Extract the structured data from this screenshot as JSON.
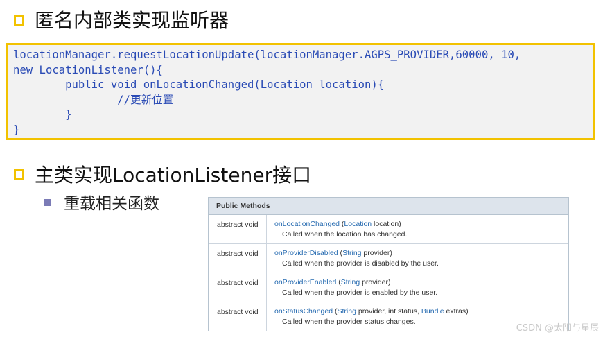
{
  "heading1": "匿名内部类实现监听器",
  "code_lines": [
    "locationManager.requestLocationUpdate(locationManager.AGPS_PROVIDER,60000, 10,",
    "new LocationListener(){",
    "        public void onLocationChanged(Location location){",
    "                //更新位置",
    "        }",
    "}"
  ],
  "heading2": "主类实现LocationListener接口",
  "sub_bullet": "重载相关函数",
  "methods_table": {
    "header": "Public Methods",
    "rows": [
      {
        "modifier": "abstract void",
        "name": "onLocationChanged",
        "p1": " (",
        "link": "Location",
        "p2": " location)",
        "desc": "Called when the location has changed."
      },
      {
        "modifier": "abstract void",
        "name": "onProviderDisabled",
        "p1": " (",
        "link": "String",
        "p2": " provider)",
        "desc": "Called when the provider is disabled by the user."
      },
      {
        "modifier": "abstract void",
        "name": "onProviderEnabled",
        "p1": " (",
        "link": "String",
        "p2": " provider)",
        "desc": "Called when the provider is enabled by the user."
      },
      {
        "modifier": "abstract void",
        "name": "onStatusChanged",
        "p1": " (",
        "link": "String",
        "p2": " provider, int status, ",
        "link2": "Bundle",
        "p3": " extras)",
        "desc": "Called when the provider status changes."
      }
    ]
  },
  "watermark": "CSDN @太阳与星辰",
  "colors": {
    "accent": "#f2c200",
    "code": "#2a4bb5",
    "link": "#256ab0"
  }
}
